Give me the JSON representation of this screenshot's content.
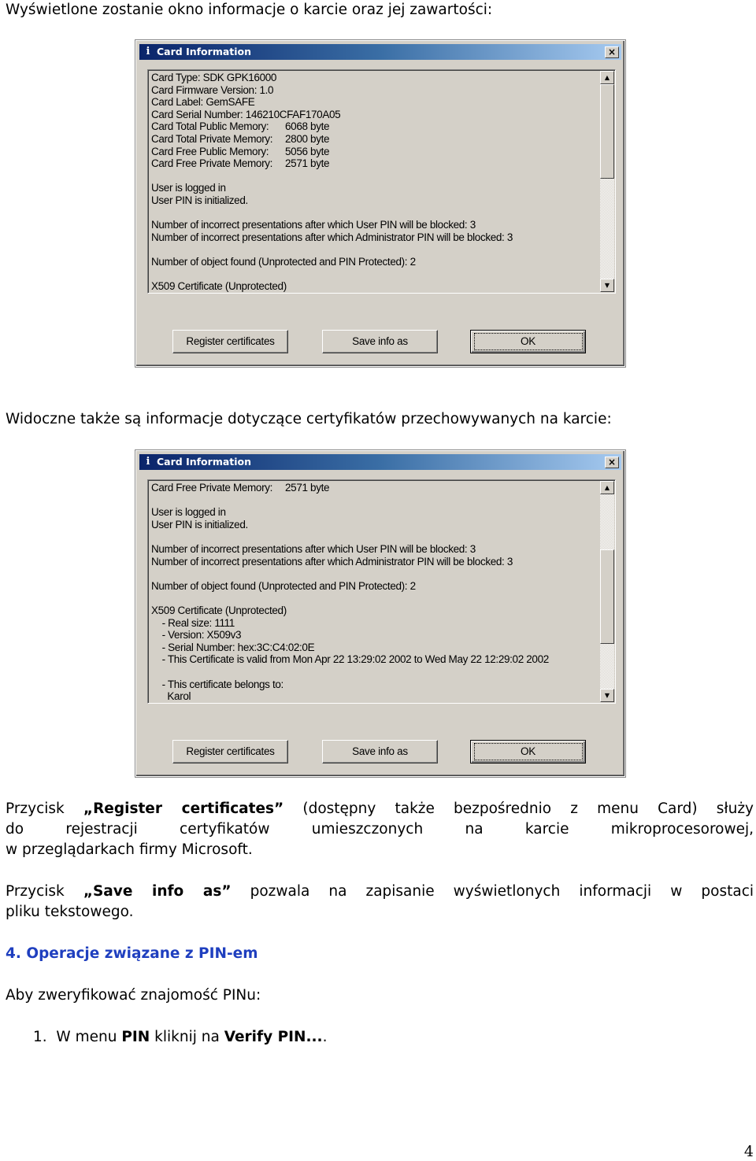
{
  "intro1": "Wyświetlone zostanie okno informacje o karcie oraz jej zawartości:",
  "intro2": "Widoczne także są informacje dotyczące certyfikatów przechowywanych na karcie:",
  "dialog": {
    "title": "Card Information",
    "close": "×",
    "buttons": {
      "register": "Register certificates",
      "save": "Save info as",
      "ok": "OK"
    },
    "scroll_position_1": 0,
    "scroll_position_2": 0.55
  },
  "lines1": [
    {
      "t": "Card Type: SDK GPK16000"
    },
    {
      "t": "Card Firmware Version: 1.0"
    },
    {
      "t": "Card Label: GemSAFE"
    },
    {
      "t": "Card Serial Number: 146210CFAF170A05"
    },
    {
      "t": "Card Total Public Memory:",
      "v": "6068 byte"
    },
    {
      "t": "Card Total Private Memory:",
      "v": "2800 byte"
    },
    {
      "t": "Card Free Public Memory:",
      "v": "5056 byte"
    },
    {
      "t": "Card Free Private Memory:",
      "v": "2571 byte"
    },
    {
      "t": ""
    },
    {
      "t": "User is logged in"
    },
    {
      "t": "User PIN is initialized."
    },
    {
      "t": ""
    },
    {
      "t": "Number of incorrect presentations after which User PIN will be blocked: 3"
    },
    {
      "t": "Number of incorrect presentations after which Administrator PIN will be blocked: 3"
    },
    {
      "t": ""
    },
    {
      "t": "Number of object found (Unprotected and PIN Protected): 2"
    },
    {
      "t": ""
    },
    {
      "t": "X509 Certificate (Unprotected)"
    }
  ],
  "lines2": [
    {
      "t": "Card Free Private Memory:",
      "v": "2571 byte"
    },
    {
      "t": ""
    },
    {
      "t": "User is logged in"
    },
    {
      "t": "User PIN is initialized."
    },
    {
      "t": ""
    },
    {
      "t": "Number of incorrect presentations after which User PIN will be blocked: 3"
    },
    {
      "t": "Number of incorrect presentations after which Administrator PIN will be blocked: 3"
    },
    {
      "t": ""
    },
    {
      "t": "Number of object found (Unprotected and PIN Protected): 2"
    },
    {
      "t": ""
    },
    {
      "t": "X509 Certificate (Unprotected)"
    },
    {
      "t": "    - Real size: 1111"
    },
    {
      "t": "    - Version: X509v3"
    },
    {
      "t": "    - Serial Number: hex:3C:C4:02:0E"
    },
    {
      "t": "    - This Certificate is valid from Mon Apr 22 13:29:02 2002 to Wed May 22 12:29:02 2002"
    },
    {
      "t": ""
    },
    {
      "t": "    - This certificate belongs to:"
    },
    {
      "t": "      Karol"
    }
  ],
  "para1": {
    "a": "Przycisk ",
    "b": "„Register certificates”",
    "c": " (dostępny także bezpośrednio z menu Card) służy",
    "l2": "do rejestracji certyfikatów umieszczonych na karcie mikroprocesorowej,",
    "l3": "w przeglądarkach firmy Microsoft."
  },
  "para2": {
    "a": "Przycisk ",
    "b": "„Save info as”",
    "c": " pozwala na zapisanie wyświetlonych informacji w postaci",
    "l2": "pliku tekstowego."
  },
  "heading": "4. Operacje związane z PIN-em",
  "para3": "Aby zweryfikować znajomość PINu:",
  "list": {
    "num": "1.",
    "a": "W menu ",
    "b": "PIN",
    "c": " kliknij na ",
    "d": "Verify PIN...",
    "e": "."
  },
  "page_number": "4",
  "colors": {
    "heading": "#1f3fbf",
    "titlebar_start": "#0a246a",
    "titlebar_end": "#a6caf0",
    "dialog_bg": "#d4d0c8"
  }
}
